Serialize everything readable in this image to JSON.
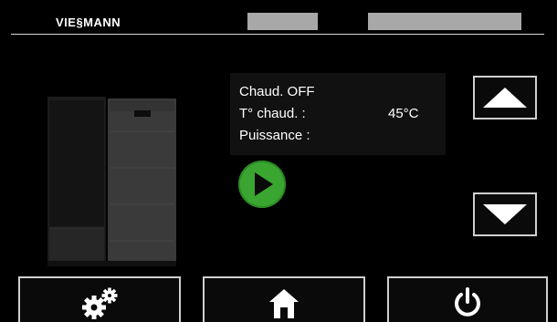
{
  "header": {
    "brand": "VIE§MANN"
  },
  "status": {
    "line1": "Chaud. OFF",
    "temp_label": "T° chaud. :",
    "temp_value": "45°C",
    "power_label": "Puissance :"
  },
  "colors": {
    "background": "#000000",
    "play_green": "#3aa631",
    "bar_gray": "#a8a8a8",
    "border": "#cfcfcf"
  },
  "icons": {
    "play": "play-icon",
    "up": "arrow-up-icon",
    "down": "arrow-down-icon",
    "settings": "gears-icon",
    "home": "home-icon",
    "power": "power-icon"
  }
}
